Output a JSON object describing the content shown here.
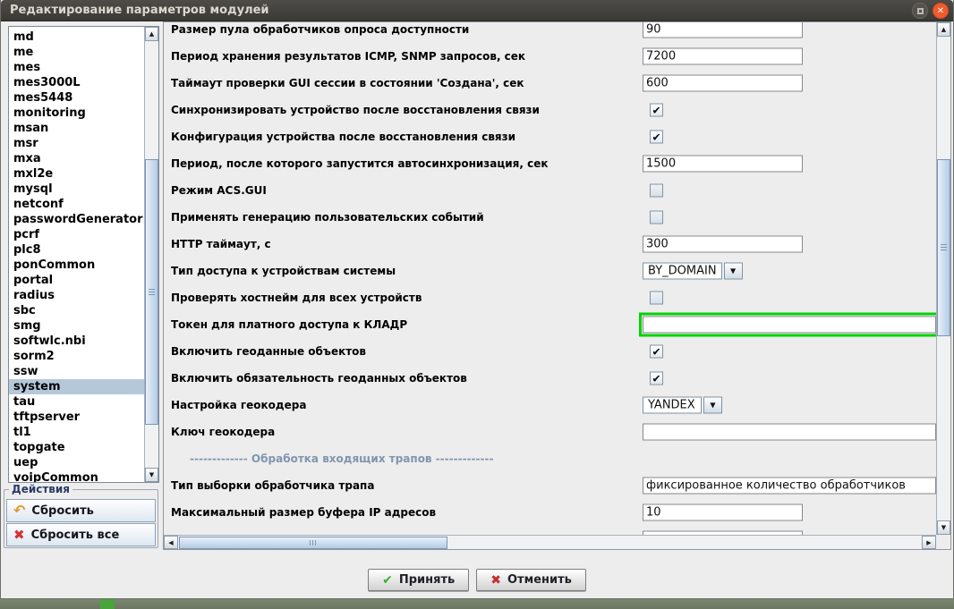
{
  "window": {
    "title": "Редактирование параметров модулей"
  },
  "sidebar": {
    "selected": "system",
    "items": [
      "md",
      "me",
      "mes",
      "mes3000L",
      "mes5448",
      "monitoring",
      "msan",
      "msr",
      "mxa",
      "mxl2e",
      "mysql",
      "netconf",
      "passwordGenerator",
      "pcrf",
      "plc8",
      "ponCommon",
      "portal",
      "radius",
      "sbc",
      "smg",
      "softwlc.nbi",
      "sorm2",
      "ssw",
      "system",
      "tau",
      "tftpserver",
      "tl1",
      "topgate",
      "uep",
      "voipCommon"
    ]
  },
  "actions": {
    "title": "Действия",
    "reset_label": "Сбросить",
    "reset_all_label": "Сбросить все"
  },
  "params": {
    "rows": [
      {
        "type": "text",
        "label": "Размер пула обработчиков опроса доступности",
        "value": "90",
        "wide": false
      },
      {
        "type": "text",
        "label": "Период хранения результатов ICMP, SNMP запросов, сек",
        "value": "7200",
        "wide": false
      },
      {
        "type": "text",
        "label": "Таймаут проверки GUI сессии в состоянии 'Создана', сек",
        "value": "600",
        "wide": false
      },
      {
        "type": "checkbox",
        "label": "Синхронизировать устройство после восстановления связи",
        "checked": true
      },
      {
        "type": "checkbox",
        "label": "Конфигурация устройства после восстановления связи",
        "checked": true
      },
      {
        "type": "text",
        "label": "Период, после которого запустится автосинхронизация, сек",
        "value": "1500",
        "wide": false
      },
      {
        "type": "checkbox",
        "label": "Режим ACS.GUI",
        "checked": false
      },
      {
        "type": "checkbox",
        "label": "Применять генерацию пользовательских событий",
        "checked": false
      },
      {
        "type": "text",
        "label": "HTTP таймаут, с",
        "value": "300",
        "wide": false
      },
      {
        "type": "combo",
        "label": "Тип доступа к устройствам системы",
        "value": "BY_DOMAIN"
      },
      {
        "type": "checkbox",
        "label": "Проверять хостнейм для всех устройств",
        "checked": false
      },
      {
        "type": "text",
        "label": "Токен для платного доступа к КЛАДР",
        "value": "",
        "wide": true,
        "highlight": true
      },
      {
        "type": "checkbox",
        "label": "Включить геоданные объектов",
        "checked": true
      },
      {
        "type": "checkbox",
        "label": "Включить обязательность геоданных объектов",
        "checked": true
      },
      {
        "type": "combo",
        "label": "Настройка геокодера",
        "value": "YANDEX"
      },
      {
        "type": "text",
        "label": "Ключ геокодера",
        "value": "",
        "wide": true
      },
      {
        "type": "section",
        "label": "------------- Обработка входящих трапов -------------"
      },
      {
        "type": "text",
        "label": "Тип выборки обработчика трапа",
        "value": "фиксированное количество обработчиков",
        "wide": true
      },
      {
        "type": "text",
        "label": "Максимальный размер буфера IP адресов",
        "value": "10",
        "wide": false
      },
      {
        "type": "text",
        "label": "",
        "value": "",
        "wide": false
      }
    ]
  },
  "footer": {
    "accept_label": "Принять",
    "cancel_label": "Отменить"
  },
  "icons": {
    "maximize": "",
    "close": "✕",
    "undo": "↶",
    "reset_all_x": "✖",
    "accept_check": "✔",
    "cancel_x": "✖",
    "checkbox_check": "✔",
    "combo_arrow": "▼",
    "scroll_up": "▲",
    "scroll_down": "▼",
    "scroll_left": "◀",
    "scroll_right": "▶"
  },
  "colors": {
    "highlight_green": "#00d400",
    "list_selection": "#b5c8da",
    "section_text": "#8095af",
    "titlebar_bg": "#3c3b37",
    "close_button": "#ee5b2e"
  }
}
